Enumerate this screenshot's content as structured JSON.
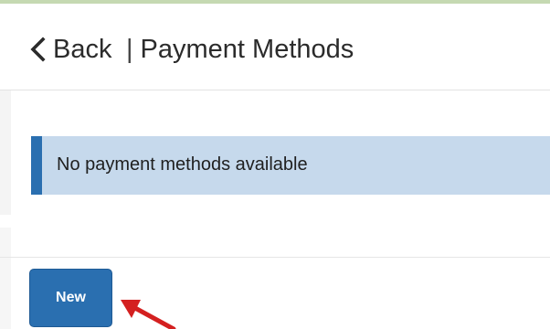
{
  "header": {
    "back_label": "Back",
    "separator": "|",
    "title": "Payment Methods",
    "back_icon": "chevron-left-icon"
  },
  "alert": {
    "message": "No payment methods available"
  },
  "actions": {
    "new_label": "New"
  },
  "annotation": {
    "arrow_icon": "red-arrow-icon",
    "color": "#d42020"
  },
  "colors": {
    "primary": "#2a6fb0",
    "alert_bg": "#c6d9ec",
    "top_accent": "#c5d9b2"
  }
}
